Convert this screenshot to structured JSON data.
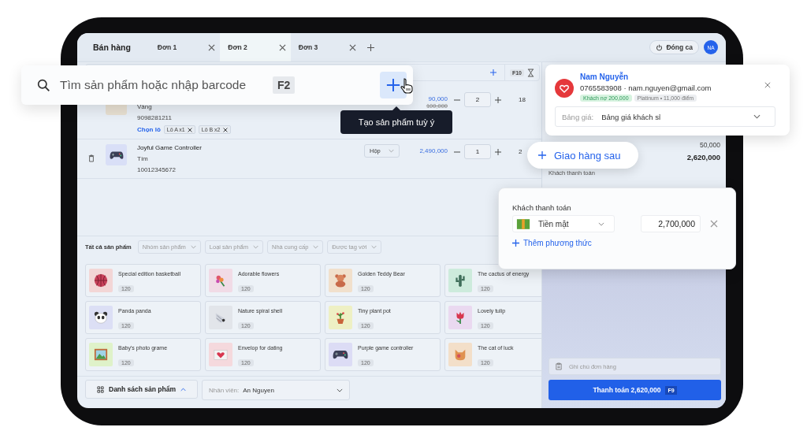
{
  "app": {
    "title": "Bán hàng"
  },
  "tabs": [
    {
      "label": "Đơn 1",
      "selected": false
    },
    {
      "label": "Đơn 2",
      "selected": true
    },
    {
      "label": "Đơn 3",
      "selected": false
    }
  ],
  "header": {
    "close_shift": "Đóng ca",
    "avatar": "NA"
  },
  "toolbar": {
    "shortcut": "F10"
  },
  "cart": [
    {
      "variant": "Vàng",
      "code": "9098281211",
      "batch_label": "Chọn lô",
      "batches": [
        "Lô A x1",
        "Lô B x2"
      ],
      "price": "90,000",
      "old_price": "100,000",
      "qty": "2",
      "total": "18"
    },
    {
      "name": "Joyful Game Controller",
      "variant": "Tím",
      "code": "10012345672",
      "unit": "Hộp",
      "price": "2,490,000",
      "qty": "1",
      "total": "2"
    }
  ],
  "filters": {
    "label": "Tất cả sản phẩm",
    "dropdowns": [
      "Nhóm sản phẩm",
      "Loại sản phẩm",
      "Nhà cung cấp",
      "Được tag với"
    ]
  },
  "products": [
    {
      "name": "Special edition basketball",
      "stock": "120",
      "kind": "basketball"
    },
    {
      "name": "Adorable flowers",
      "stock": "120",
      "kind": "flowers"
    },
    {
      "name": "Golden Teddy Bear",
      "stock": "120",
      "kind": "bear"
    },
    {
      "name": "The cactus of energy",
      "stock": "120",
      "kind": "cactus"
    },
    {
      "name": "Panda panda",
      "stock": "120",
      "kind": "panda"
    },
    {
      "name": "Nature spiral shell",
      "stock": "120",
      "kind": "shell"
    },
    {
      "name": "Tiny plant pot",
      "stock": "120",
      "kind": "plant"
    },
    {
      "name": "Lovely tulip",
      "stock": "120",
      "kind": "tulip"
    },
    {
      "name": "Baby's photo grame",
      "stock": "120",
      "kind": "photo"
    },
    {
      "name": "Envelop for dating",
      "stock": "120",
      "kind": "envelope"
    },
    {
      "name": "Purple game controller",
      "stock": "120",
      "kind": "gamepad"
    },
    {
      "name": "The cat of luck",
      "stock": "120",
      "kind": "cat"
    }
  ],
  "bottom_bar": {
    "list_button": "Danh sách sản phẩm",
    "staff_label": "Nhân viên:",
    "staff": "An Nguyen"
  },
  "summary": {
    "amount": "50,000",
    "total": "2,620,000",
    "paid_label": "Khách thanh toán"
  },
  "note": {
    "placeholder": "Ghi chú đơn hàng"
  },
  "pay_button": {
    "label": "Thanh toán 2,620,000",
    "shortcut": "F9"
  },
  "search_popup": {
    "placeholder": "Tìm sản phẩm hoặc nhập barcode",
    "shortcut": "F2",
    "tooltip": "Tạo sản phẩm tuỳ ý"
  },
  "customer_card": {
    "name": "Nam Nguyễn",
    "contact": "0765583908 · nam.nguyen@gmail.com",
    "badges": [
      {
        "text": "Khách nợ 200,000",
        "kind": "debt"
      },
      {
        "text": "Platinum • 11,000 điểm",
        "kind": "tier"
      }
    ],
    "price_list_label": "Bảng giá:",
    "price_list": "Bảng giá khách sỉ"
  },
  "delivery_button": {
    "label": "Giao hàng sau"
  },
  "payment_card": {
    "title": "Khách thanh toán",
    "method": "Tiền mặt",
    "amount": "2,700,000",
    "add_method": "Thêm phương thức"
  }
}
